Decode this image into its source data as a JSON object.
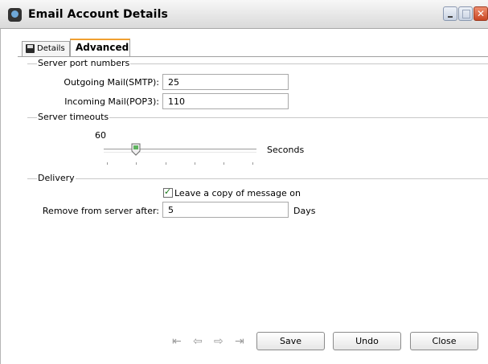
{
  "window": {
    "title": "Email Account Details"
  },
  "tabs": [
    {
      "label": "Details",
      "active": false
    },
    {
      "label": "Advanced",
      "active": true
    }
  ],
  "server_ports": {
    "title": "Server port numbers",
    "outgoing_label": "Outgoing Mail(SMTP):",
    "outgoing_value": "25",
    "incoming_label": "Incoming Mail(POP3):",
    "incoming_value": "110"
  },
  "server_timeouts": {
    "title": "Server timeouts",
    "value": "60",
    "unit": "Seconds"
  },
  "delivery": {
    "title": "Delivery",
    "leave_copy_label": "Leave a copy of message on",
    "leave_copy_checked": true,
    "remove_label": "Remove from server after:",
    "remove_value": "5",
    "remove_unit": "Days"
  },
  "nav_icons": [
    "first-record-icon",
    "previous-record-icon",
    "next-record-icon",
    "last-record-icon"
  ],
  "buttons": {
    "save": "Save",
    "undo": "Undo",
    "close": "Close"
  },
  "colors": {
    "active_tab_accent": "#f0a030",
    "close_button": "#c94523"
  }
}
